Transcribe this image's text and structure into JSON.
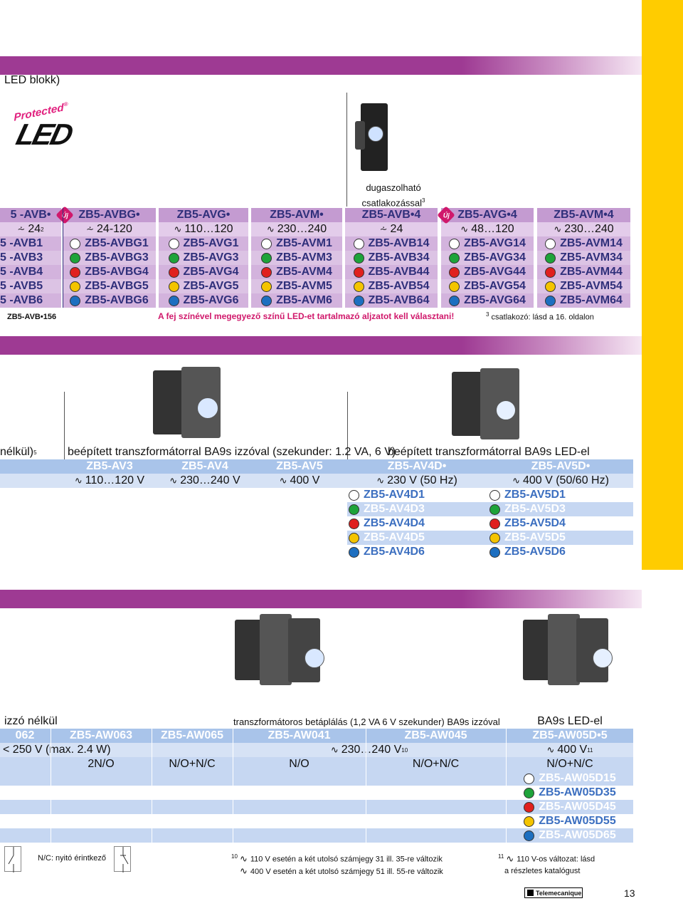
{
  "section1": {
    "heading": "LED blokk)",
    "logo": {
      "protected": "Protected",
      "reg": "®",
      "led": "LED"
    },
    "connector_caption": [
      "dugaszolható",
      "csatlakozással"
    ],
    "connector_sup": "3",
    "header_row": [
      "5 -AVB•",
      "ZB5-AVBG•",
      "ZB5-AVG•",
      "ZB5-AVM•",
      "ZB5-AVB•4",
      "ZB5-AVG•4",
      "ZB5-AVM•4"
    ],
    "voltage_row": [
      {
        "sym": "⩪",
        "text": "24",
        "sup": "2"
      },
      {
        "sym": "⩪",
        "text": "24-120",
        "sup": ""
      },
      {
        "sym": "∿",
        "text": "110…120",
        "sup": ""
      },
      {
        "sym": "∿",
        "text": "230…240",
        "sup": ""
      },
      {
        "sym": "⩪",
        "text": "24",
        "sup": ""
      },
      {
        "sym": "∿",
        "text": "48…120",
        "sup": ""
      },
      {
        "sym": "∿",
        "text": "230…240",
        "sup": ""
      }
    ],
    "new_badge": "Új",
    "rows": [
      {
        "dot": "#ffffff",
        "cells": [
          "5 -AVB1",
          "ZB5-AVBG1",
          "ZB5-AVG1",
          "ZB5-AVM1",
          "ZB5-AVB14",
          "ZB5-AVG14",
          "ZB5-AVM14"
        ]
      },
      {
        "dot": "#1ea33a",
        "cells": [
          "5 -AVB3",
          "ZB5-AVBG3",
          "ZB5-AVG3",
          "ZB5-AVM3",
          "ZB5-AVB34",
          "ZB5-AVG34",
          "ZB5-AVM34"
        ]
      },
      {
        "dot": "#e0201e",
        "cells": [
          "5 -AVB4",
          "ZB5-AVBG4",
          "ZB5-AVG4",
          "ZB5-AVM4",
          "ZB5-AVB44",
          "ZB5-AVG44",
          "ZB5-AVM44"
        ]
      },
      {
        "dot": "#f4c400",
        "cells": [
          "5 -AVB5",
          "ZB5-AVBG5",
          "ZB5-AVG5",
          "ZB5-AVM5",
          "ZB5-AVB54",
          "ZB5-AVG54",
          "ZB5-AVM54"
        ]
      },
      {
        "dot": "#1d6fc0",
        "cells": [
          "5 -AVB6",
          "ZB5-AVBG6",
          "ZB5-AVG6",
          "ZB5-AVM6",
          "ZB5-AVB64",
          "ZB5-AVG64",
          "ZB5-AVM64"
        ]
      }
    ],
    "extra_ref": "ZB5-AVB•156",
    "warning": "A fej színével megegyező színű LED-et tartalmazó aljzatot kell választani!",
    "footnote_sup": "3",
    "footnote": "csatlakozó: lásd a 16. oldalon"
  },
  "section2": {
    "left_label": "nélkül)",
    "left_sup": "5",
    "group1_title": "beépített transzformátorral BA9s izzóval (szekunder: 1.2 VA, 6 V)",
    "group2_title": "beépített transzformátorral BA9s LED-el",
    "header_row": [
      "ZB5-AV3",
      "ZB5-AV4",
      "ZB5-AV5",
      "ZB5-AV4D•",
      "ZB5-AV5D•"
    ],
    "voltage_row": [
      "110…120 V",
      "230…240 V",
      "400 V",
      "230 V (50 Hz)",
      "400 V  (50/60 Hz)"
    ],
    "voltage_sym": "∿",
    "led_rows": [
      {
        "dot": "#ffffff",
        "cells": [
          "ZB5-AV4D1",
          "ZB5-AV5D1"
        ]
      },
      {
        "dot": "#1ea33a",
        "cells": [
          "ZB5-AV4D3",
          "ZB5-AV5D3"
        ]
      },
      {
        "dot": "#e0201e",
        "cells": [
          "ZB5-AV4D4",
          "ZB5-AV5D4"
        ]
      },
      {
        "dot": "#f4c400",
        "cells": [
          "ZB5-AV4D5",
          "ZB5-AV5D5"
        ]
      },
      {
        "dot": "#1d6fc0",
        "cells": [
          "ZB5-AV4D6",
          "ZB5-AV5D6"
        ]
      }
    ]
  },
  "section3": {
    "group1_title": "izzó nélkül",
    "group2_title": "transzformátoros betáplálás (1,2 VA 6 V szekunder) BA9s izzóval",
    "group3_title": "BA9s LED-el",
    "header_row": [
      "062",
      "ZB5-AW063",
      "ZB5-AW065",
      "ZB5-AW041",
      "ZB5-AW045",
      "ZB5-AW05D•5"
    ],
    "voltage1": "< 250 V (max. 2.4 W)",
    "voltage2": "230…240 V",
    "voltage2_sup": "10",
    "voltage3": "400 V",
    "voltage3_sup": "11",
    "voltage_sym": "∿",
    "contact_row": [
      "2N/O",
      "N/O+N/C",
      "N/O",
      "N/O+N/C",
      "N/O+N/C"
    ],
    "led_rows": [
      {
        "dot": "#ffffff",
        "cell": "ZB5-AW05D15"
      },
      {
        "dot": "#1ea33a",
        "cell": "ZB5-AW05D35"
      },
      {
        "dot": "#e0201e",
        "cell": "ZB5-AW05D45"
      },
      {
        "dot": "#f4c400",
        "cell": "ZB5-AW05D55"
      },
      {
        "dot": "#1d6fc0",
        "cell": "ZB5-AW05D65"
      }
    ]
  },
  "footer": {
    "nc_label": "N/C: nyitó érintkező",
    "fn10_num": "10",
    "fn10_line1": "110 V esetén a két utolsó számjegy 31 ill. 35-re változik",
    "fn10_line2": "400 V esetén a két utolsó számjegy 51 ill. 55-re változik",
    "fn11_num": "11",
    "fn11_line1": "110 V-os változat: lásd",
    "fn11_line2": "a részletes katalógust",
    "brand": "Telemecanique",
    "page_number": "13"
  },
  "colors": {
    "purple_band": "#9e3a93",
    "yellow_bar": "#ffcc00",
    "lavender_header": "#c49bd1",
    "blue_header": "#a9c4ea",
    "warning_pink": "#d0186b"
  }
}
